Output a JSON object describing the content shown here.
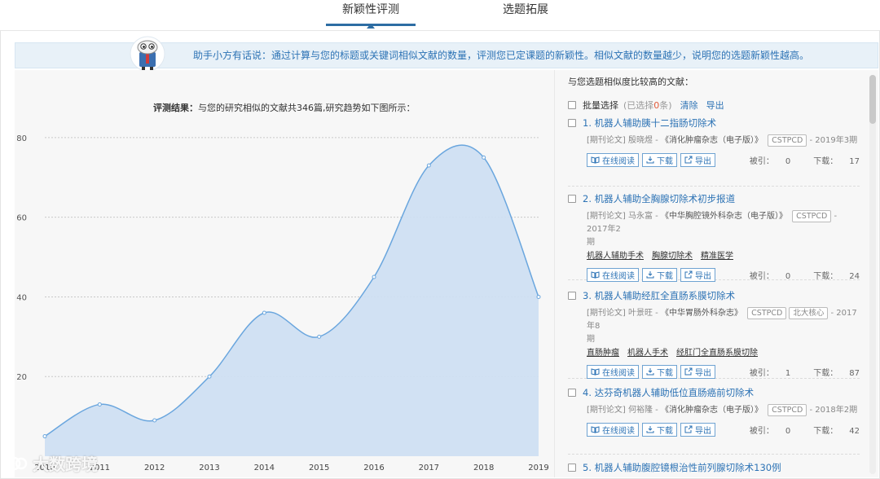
{
  "tabs": [
    {
      "label": "新颖性评测",
      "active": true
    },
    {
      "label": "选题拓展",
      "active": false
    }
  ],
  "banner": {
    "speaker": "助手小方有话说：",
    "text": "通过计算与您的标题或关键词相似文献的数量，评测您已定课题的新颖性。相似文献的数量越少，说明您的选题新颖性越高。"
  },
  "result": {
    "label": "评测结果：",
    "text": "与您的研究相似的文献共346篇,研究趋势如下图所示："
  },
  "chart_data": {
    "type": "area",
    "x": [
      "2010",
      "2011",
      "2012",
      "2013",
      "2014",
      "2015",
      "2016",
      "2017",
      "2018",
      "2019"
    ],
    "values": [
      5,
      13,
      9,
      20,
      36,
      30,
      45,
      73,
      75,
      40
    ],
    "ylim": [
      0,
      90
    ],
    "yticks": [
      "80",
      "60",
      "40",
      "20"
    ],
    "grid": true,
    "fill_color": "#cfdff2",
    "line_color": "#6aa6de"
  },
  "list": {
    "heading": "与您选题相似度比较高的文献：",
    "batch_label": "批量选择",
    "selected_prefix": "(已选择",
    "selected_count": "0",
    "selected_suffix": "条)",
    "clear": "清除",
    "export": "导出",
    "read_online": "在线阅读",
    "download": "下载",
    "export_btn": "导出",
    "cited_label": "被引：",
    "download_label": "下载：",
    "items": [
      {
        "title": "1. 机器人辅助胰十二指肠切除术",
        "type": "[期刊论文]",
        "author": "殷晓煜",
        "journal": "《消化肿瘤杂志（电子版）》",
        "tags": [
          "CSTPCD"
        ],
        "date": "- 2019年3期",
        "date2": "",
        "keywords": [],
        "cited": "0",
        "downloads": "17"
      },
      {
        "title": "2. 机器人辅助全胸腺切除术初步报道",
        "type": "[期刊论文]",
        "author": "马永富",
        "journal": "《中华胸腔镜外科杂志（电子版）》",
        "tags": [
          "CSTPCD"
        ],
        "date": "- 2017年2",
        "date2": "期",
        "keywords": [
          "机器人辅助手术",
          "胸腺切除术",
          "精准医学"
        ],
        "cited": "0",
        "downloads": "24"
      },
      {
        "title": "3. 机器人辅助经肛全直肠系膜切除术",
        "type": "[期刊论文]",
        "author": "叶景旺",
        "journal": "《中华胃肠外科杂志》",
        "tags": [
          "CSTPCD",
          "北大核心"
        ],
        "date": "- 2017年8",
        "date2": "期",
        "keywords": [
          "直肠肿瘤",
          "机器人手术",
          "经肛门全直肠系膜切除"
        ],
        "cited": "1",
        "downloads": "87"
      },
      {
        "title": "4. 达芬奇机器人辅助低位直肠癌前切除术",
        "type": "[期刊论文]",
        "author": "何裕隆",
        "journal": "《消化肿瘤杂志（电子版）》",
        "tags": [
          "CSTPCD"
        ],
        "date": "- 2018年2期",
        "date2": "",
        "keywords": [],
        "cited": "0",
        "downloads": "42"
      },
      {
        "title": "5. 机器人辅助腹腔镜根治性前列腺切除术130例"
      }
    ]
  },
  "watermark": "大数跨境"
}
